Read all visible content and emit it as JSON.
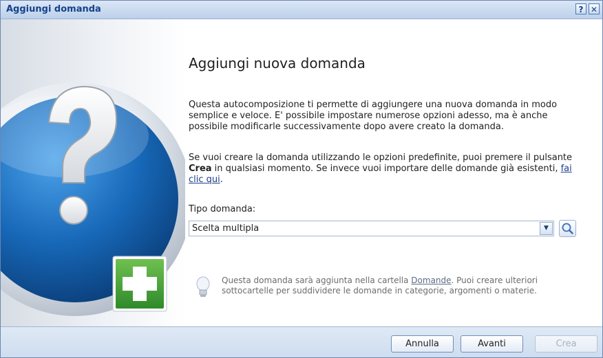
{
  "window": {
    "title": "Aggiungi domanda"
  },
  "titlebar": {
    "help_label": "?",
    "close_label": "✕"
  },
  "content": {
    "heading": "Aggiungi nuova domanda",
    "paragraph1": "Questa autocomposizione ti permette di aggiungere una nuova domanda in modo semplice e veloce. E' possibile impostare numerose opzioni adesso, ma è anche possibile modificarle successivamente dopo avere creato la domanda.",
    "paragraph2_part1": "Se vuoi creare la domanda utilizzando le opzioni predefinite, puoi premere il pulsante ",
    "paragraph2_bold": "Crea",
    "paragraph2_part2": " in qualsiasi momento. Se invece vuoi importare delle domande già esistenti, ",
    "paragraph2_link": "fai clic qui",
    "paragraph2_end": ".",
    "tipo_label": "Tipo domanda:",
    "tipo_value": "Scelta multipla",
    "tip_part1": "Questa domanda sarà aggiunta nella cartella ",
    "tip_link": "Domande",
    "tip_part2": ". Puoi creare ulteriori sottocartelle per suddividere le domande in categorie, argomenti o materie."
  },
  "buttons": {
    "cancel": "Annulla",
    "next": "Avanti",
    "create": "Crea"
  },
  "icons": [
    "question-mark-icon",
    "add-plus-icon",
    "dropdown-arrow-icon",
    "magnifier-icon",
    "lightbulb-icon",
    "help-icon",
    "close-icon"
  ],
  "colors": {
    "title_text": "#15428b",
    "accent_blue": "#1a5fa8",
    "add_green": "#3f9a2f"
  }
}
